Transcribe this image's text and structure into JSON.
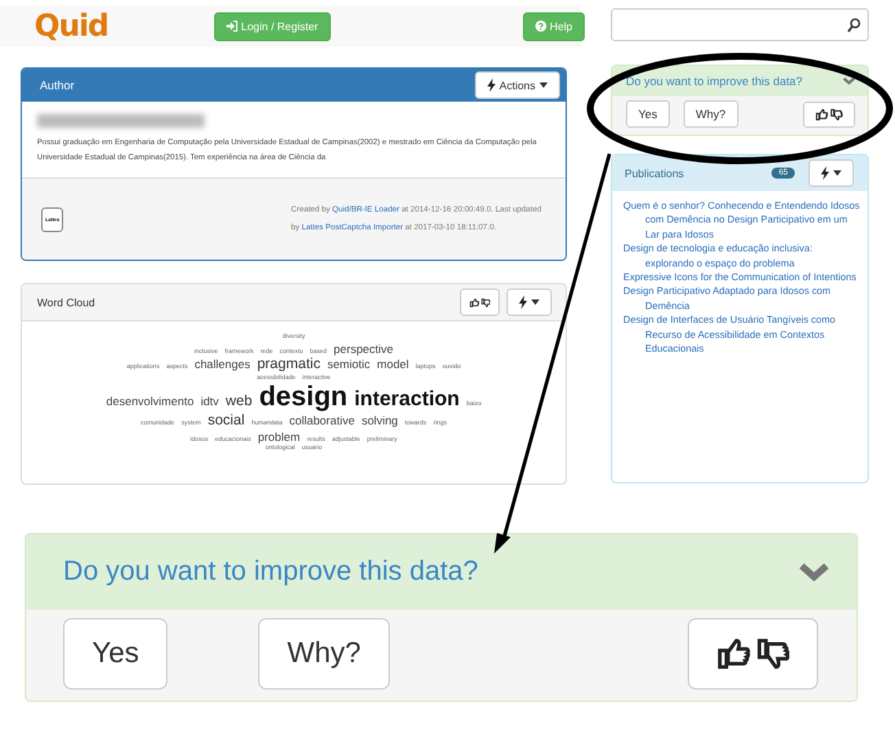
{
  "header": {
    "logo": "Quid",
    "login_button": "Login / Register",
    "help_button": "Help"
  },
  "author_panel": {
    "title": "Author",
    "actions_button": "Actions",
    "bio": "Possui graduação em Engenharia de Computação pela Universidade Estadual de Campinas(2002) e mestrado em Ciência da Computação pela Universidade Estadual de Campinas(2015). Tem experiência na área de Ciência da",
    "badge": "Lattes",
    "created_prefix": "Created by ",
    "created_link": "Quid/BR-IE Loader",
    "created_suffix": " at 2014-12-16 20:00:49.0.",
    "updated_prefix": "Last updated by ",
    "updated_link": "Lattes PostCaptcha Importer",
    "updated_suffix": " at 2017-03-10 18:11:07.0."
  },
  "word_cloud": {
    "title": "Word Cloud",
    "rows": [
      [
        {
          "text": "diversity",
          "kind": "xs"
        }
      ],
      [
        {
          "text": "inclusive",
          "kind": "xs"
        },
        {
          "text": "framework",
          "kind": "xs"
        },
        {
          "text": "rede",
          "kind": "xs"
        },
        {
          "text": "contexto",
          "kind": "xs"
        },
        {
          "text": "based",
          "kind": "xs"
        },
        {
          "text": "perspective",
          "kind": "s"
        }
      ],
      [
        {
          "text": "applications",
          "kind": "xs"
        },
        {
          "text": "aspects",
          "kind": "xs"
        },
        {
          "text": "challenges",
          "kind": "s"
        },
        {
          "text": "pragmatic",
          "kind": "m"
        },
        {
          "text": "semiotic",
          "kind": "s"
        },
        {
          "text": "model",
          "kind": "s"
        },
        {
          "text": "laptops",
          "kind": "xs"
        },
        {
          "text": "ouvido",
          "kind": "xs"
        }
      ],
      [
        {
          "text": "acessibilidade",
          "kind": "xs"
        },
        {
          "text": "interactive",
          "kind": "xs"
        }
      ],
      [
        {
          "text": "desenvolvimento",
          "kind": "s"
        },
        {
          "text": "idtv",
          "kind": "s"
        },
        {
          "text": "web",
          "kind": "m"
        },
        {
          "text": "design",
          "kind": "xl"
        },
        {
          "text": "interaction",
          "kind": "l"
        },
        {
          "text": "baixo",
          "kind": "xs"
        }
      ],
      [
        {
          "text": "comunidade",
          "kind": "xs"
        },
        {
          "text": "system",
          "kind": "xs"
        },
        {
          "text": "social",
          "kind": "m"
        },
        {
          "text": "humandata",
          "kind": "xs"
        },
        {
          "text": "collaborative",
          "kind": "s"
        },
        {
          "text": "solving",
          "kind": "s"
        },
        {
          "text": "towards",
          "kind": "xs"
        },
        {
          "text": "rings",
          "kind": "xs"
        }
      ],
      [
        {
          "text": "idosos",
          "kind": "xs"
        },
        {
          "text": "educacionais",
          "kind": "xs"
        },
        {
          "text": "problem",
          "kind": "s"
        },
        {
          "text": "results",
          "kind": "xs"
        },
        {
          "text": "adjustable",
          "kind": "xs"
        },
        {
          "text": "preliminary",
          "kind": "xs"
        }
      ],
      [
        {
          "text": "ontological",
          "kind": "xs"
        },
        {
          "text": "usuário",
          "kind": "xs"
        }
      ]
    ]
  },
  "improve_panel": {
    "question": "Do you want to improve this data?",
    "yes_button": "Yes",
    "why_button": "Why?"
  },
  "publications": {
    "title": "Publications",
    "count": "65",
    "items": [
      "Quem é o senhor? Conhecendo e Entendendo Idosos com Demência no Design Participativo em um Lar para Idosos",
      "Design de tecnologia e educação inclusiva: explorando o espaço do problema",
      "Expressive Icons for the Communication of Intentions",
      "Design Participativo Adaptado para Idosos com Demência",
      "Design de Interfaces de Usuário Tangíveis como Recurso de Acessibilidade em Contextos Educacionais"
    ]
  },
  "zoomed_improve_panel": {
    "question": "Do you want to improve this data?",
    "yes_button": "Yes",
    "why_button": "Why?"
  }
}
